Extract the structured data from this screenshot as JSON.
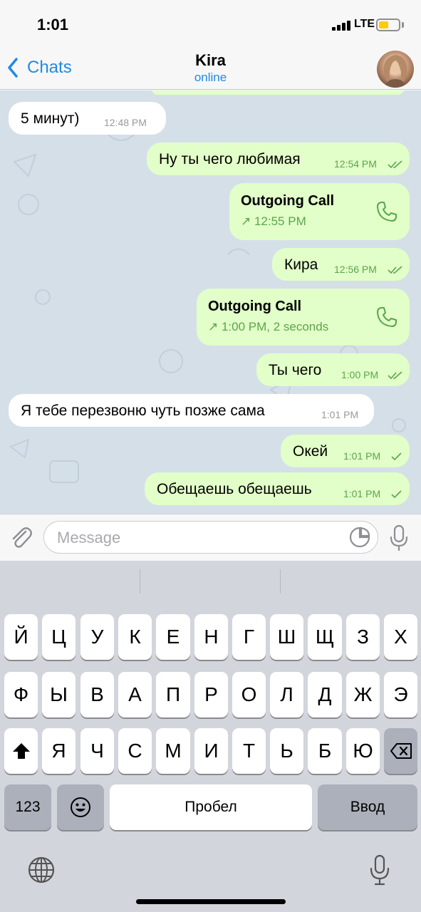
{
  "status_bar": {
    "time": "1:01",
    "network": "LTE",
    "battery_color": "#ffcc00"
  },
  "nav": {
    "back_label": "Chats",
    "title": "Kira",
    "subtitle": "online",
    "accent": "#1f8ae8"
  },
  "messages": [
    {
      "dir": "in",
      "text": "5 минут)",
      "time": "12:48 PM"
    },
    {
      "dir": "out",
      "text": "Ну ты чего любимая",
      "time": "12:54 PM",
      "status": "read"
    },
    {
      "dir": "out",
      "type": "call",
      "title": "Outgoing Call",
      "detail": "↗ 12:55 PM"
    },
    {
      "dir": "out",
      "text": "Кира",
      "time": "12:56 PM",
      "status": "read"
    },
    {
      "dir": "out",
      "type": "call",
      "title": "Outgoing Call",
      "detail": "↗ 1:00 PM, 2 seconds"
    },
    {
      "dir": "out",
      "text": "Ты чего",
      "time": "1:00 PM",
      "status": "read"
    },
    {
      "dir": "in",
      "text": "Я тебе перезвоню чуть позже сама",
      "time": "1:01 PM"
    },
    {
      "dir": "out",
      "text": "Окей",
      "time": "1:01 PM",
      "status": "sent"
    },
    {
      "dir": "out",
      "text": "Обещаешь обещаешь",
      "time": "1:01 PM",
      "status": "sent"
    }
  ],
  "input": {
    "placeholder": "Message",
    "value": ""
  },
  "keyboard": {
    "row1": [
      "Й",
      "Ц",
      "У",
      "К",
      "Е",
      "Н",
      "Г",
      "Ш",
      "Щ",
      "З",
      "Х"
    ],
    "row2": [
      "Ф",
      "Ы",
      "В",
      "А",
      "П",
      "Р",
      "О",
      "Л",
      "Д",
      "Ж",
      "Э"
    ],
    "row3": [
      "Я",
      "Ч",
      "С",
      "М",
      "И",
      "Т",
      "Ь",
      "Б",
      "Ю"
    ],
    "numbers_label": "123",
    "space_label": "Пробел",
    "return_label": "Ввод",
    "shift_icon": "shift-icon",
    "delete_icon": "backspace-icon",
    "emoji_icon": "emoji-icon"
  },
  "colors": {
    "outgoing_bubble": "#e2fec9",
    "incoming_bubble": "#ffffff",
    "chat_bg": "#d5dfe8",
    "tick_green": "#5aa64b"
  }
}
